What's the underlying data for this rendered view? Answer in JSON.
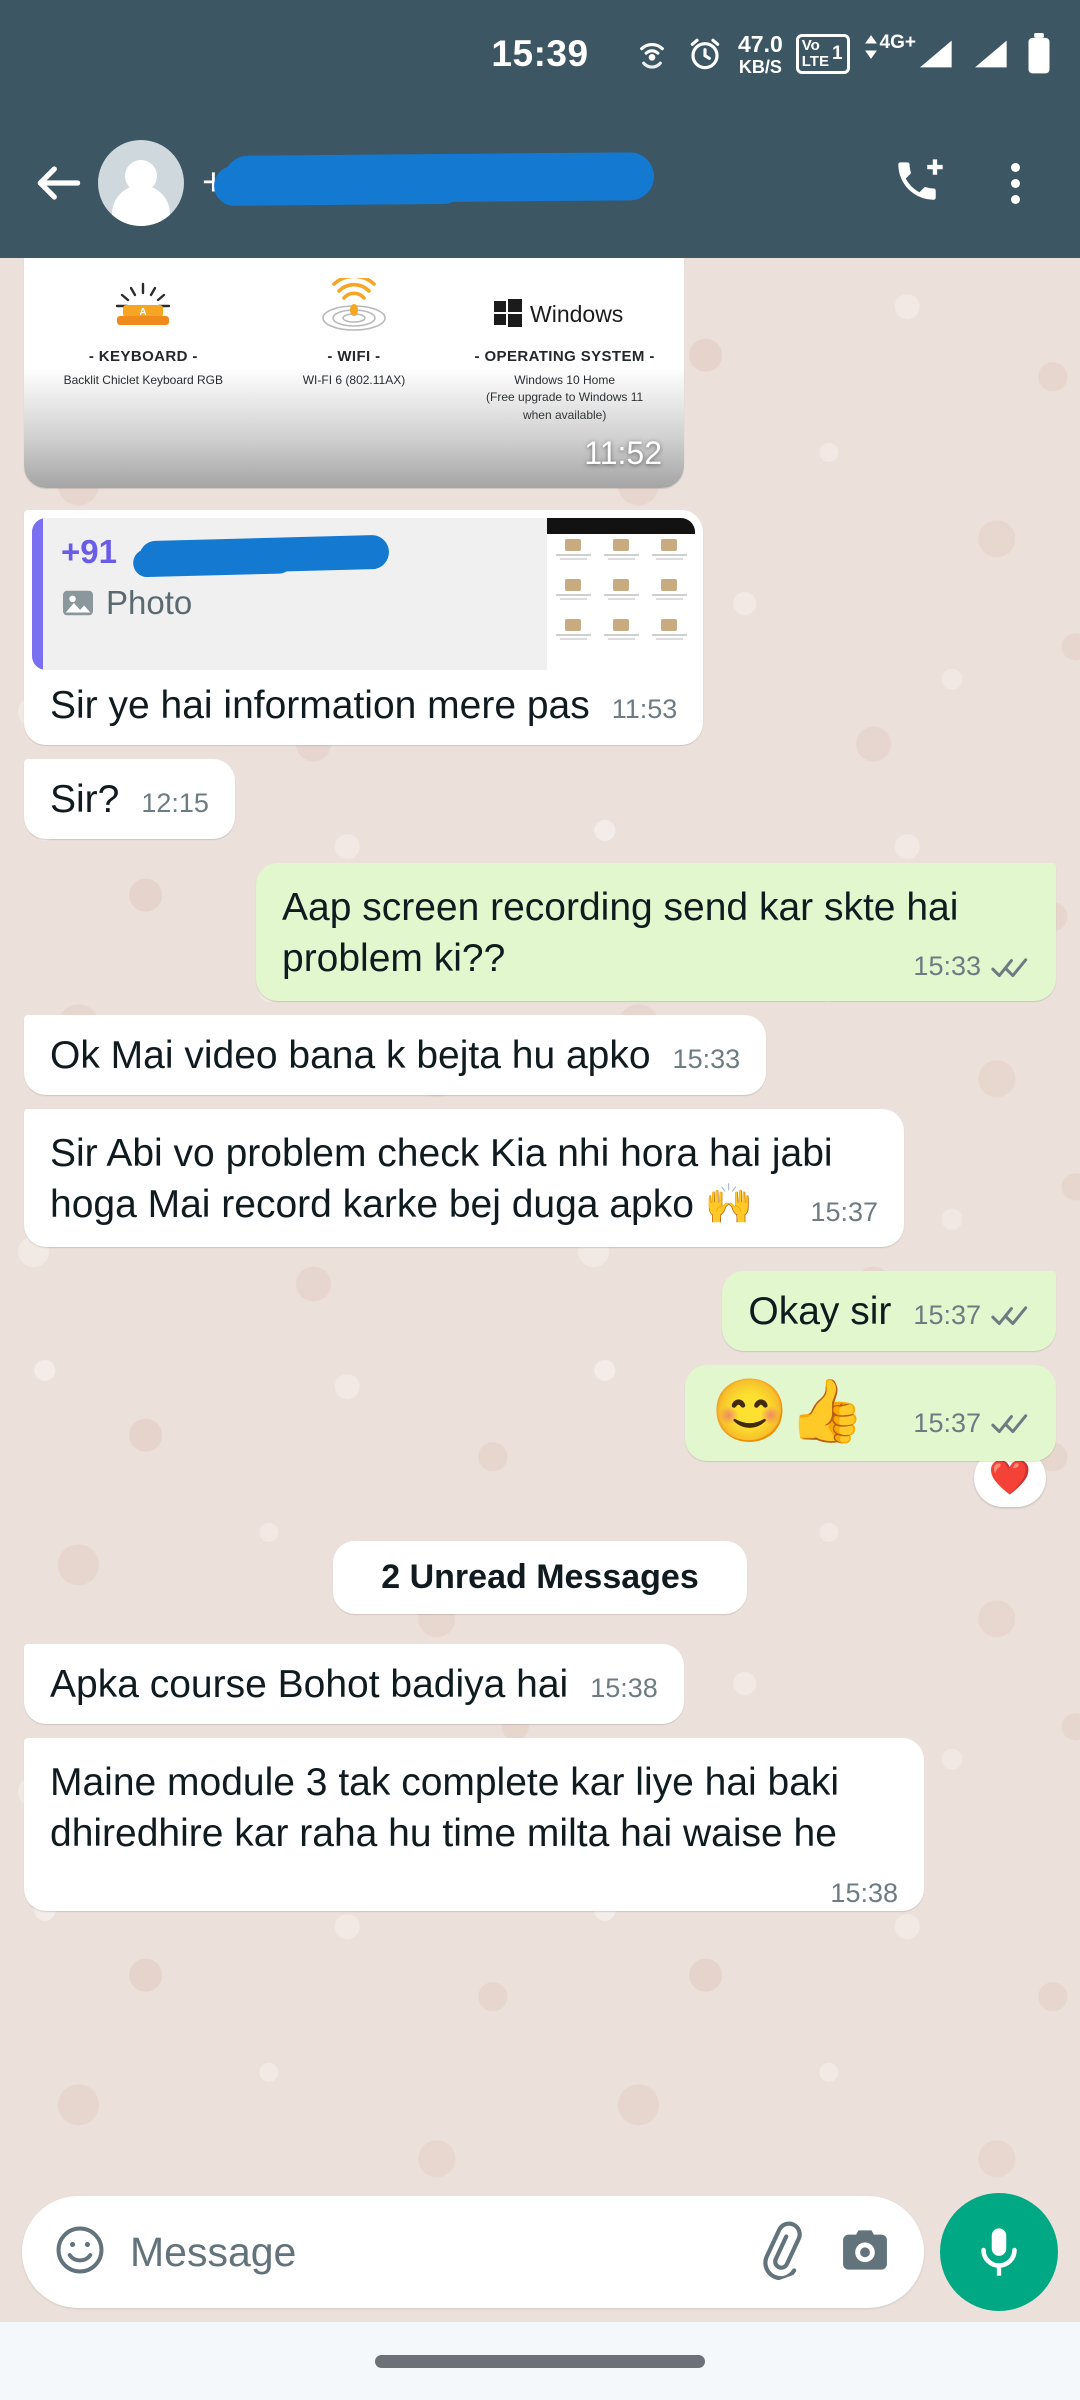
{
  "status_bar": {
    "time": "15:39",
    "network_speed_value": "47.0",
    "network_speed_unit": "KB/S",
    "volte_label_top": "Vo",
    "volte_label_bottom": "LTE",
    "sim_number": "1",
    "network_type": "4G+",
    "icons": [
      "hotspot-icon",
      "alarm-clock-icon",
      "volte-icon",
      "signal-icon",
      "signal-icon-2",
      "battery-icon"
    ]
  },
  "header": {
    "contact_name": "+91",
    "redacted": true,
    "back_icon": "back-arrow-icon",
    "avatar_icon": "default-contact-avatar",
    "call_icon": "add-call-icon",
    "menu_icon": "overflow-menu-icon"
  },
  "messages": [
    {
      "id": "m1",
      "type": "image",
      "direction": "incoming",
      "time": "11:52",
      "image_content": {
        "columns": [
          {
            "icon": "keyboard-icon",
            "heading": "- KEYBOARD -",
            "detail": "Backlit Chiclet Keyboard RGB"
          },
          {
            "icon": "wifi-icon",
            "heading": "- WIFI -",
            "detail": "WI-FI 6 (802.11AX)"
          },
          {
            "icon": "windows-logo-icon",
            "heading": "- OPERATING SYSTEM -",
            "detail": "Windows 10 Home\n(Free upgrade to Windows 11\nwhen available)"
          }
        ]
      }
    },
    {
      "id": "m2",
      "type": "text-with-quote",
      "direction": "incoming",
      "text": "Sir ye hai information mere pas",
      "time": "11:53",
      "quote": {
        "author": "+91",
        "preview_label": "Photo",
        "preview_icon": "photo-icon"
      }
    },
    {
      "id": "m3",
      "type": "text",
      "direction": "incoming",
      "text": "Sir?",
      "time": "12:15"
    },
    {
      "id": "m4",
      "type": "text",
      "direction": "outgoing",
      "text": "Aap screen recording send kar skte hai problem ki??",
      "time": "15:33",
      "status": "delivered"
    },
    {
      "id": "m5",
      "type": "text",
      "direction": "incoming",
      "text": "Ok Mai video bana k bejta hu apko",
      "time": "15:33"
    },
    {
      "id": "m6",
      "type": "text",
      "direction": "incoming",
      "text": "Sir Abi vo problem check Kia nhi hora hai jabi hoga Mai record karke bej duga apko 🙌",
      "time": "15:37"
    },
    {
      "id": "m7",
      "type": "text",
      "direction": "outgoing",
      "text": "Okay sir",
      "time": "15:37",
      "status": "delivered"
    },
    {
      "id": "m8",
      "type": "emoji",
      "direction": "outgoing",
      "text": "😊👍",
      "time": "15:37",
      "status": "delivered",
      "reaction": "❤️"
    },
    {
      "id": "m9",
      "type": "text",
      "direction": "incoming",
      "text": "Apka course Bohot badiya hai",
      "time": "15:38"
    },
    {
      "id": "m10",
      "type": "text",
      "direction": "incoming",
      "text": "Maine module 3 tak complete kar liye hai baki dhiredhire kar raha hu time milta hai waise he",
      "time": "15:38"
    }
  ],
  "unread_divider": {
    "label": "2 Unread Messages"
  },
  "input_bar": {
    "placeholder": "Message",
    "emoji_icon": "emoji-smiley-icon",
    "attach_icon": "paperclip-icon",
    "camera_icon": "camera-icon",
    "mic_icon": "microphone-icon"
  },
  "colors": {
    "header": "#3c5663",
    "chat_background": "#ece0da",
    "outgoing_bubble": "#e2f7cd",
    "incoming_bubble": "#ffffff",
    "mic_button": "#00a884",
    "redaction": "#1479d0",
    "quote_accent": "#7a6ff0"
  }
}
